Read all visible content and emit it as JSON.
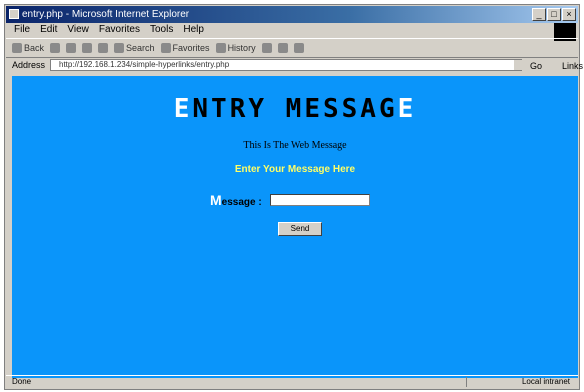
{
  "window": {
    "title": "entry.php - Microsoft Internet Explorer"
  },
  "menu": [
    "File",
    "Edit",
    "View",
    "Favorites",
    "Tools",
    "Help"
  ],
  "toolbar": {
    "back": "Back",
    "search": "Search",
    "favorites": "Favorites",
    "history": "History"
  },
  "address": {
    "label": "Address",
    "url": "http://192.168.1.234/simple-hyperlinks/entry.php",
    "go": "Go",
    "links": "Links"
  },
  "page": {
    "heading_first": "E",
    "heading_mid": "NTRY MESSAG",
    "heading_last": "E",
    "subtitle": "This Is The Web Message",
    "prompt": "Enter Your Message Here",
    "message_label_cap": "M",
    "message_label_rest": "essage :",
    "send_label": "Send"
  },
  "status": {
    "left": "Done",
    "right": "Local intranet"
  },
  "colors": {
    "page_bg": "#0a95fa",
    "prompt": "#ffff66"
  }
}
